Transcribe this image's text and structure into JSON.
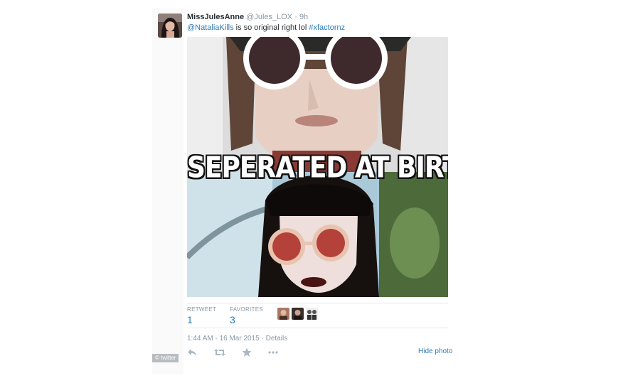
{
  "tweet": {
    "display_name": "MissJulesAnne",
    "handle": "@Jules_LOX",
    "separator": "·",
    "time_ago": "9h",
    "text": {
      "mention": "@NataliaKills",
      "body": " is so original right lol ",
      "hashtag": "#xfactornz"
    },
    "media": {
      "caption": "SEPERATED AT BIRTH??"
    },
    "stats": {
      "retweets_label": "RETWEET",
      "retweets_count": "1",
      "favorites_label": "FAVORITES",
      "favorites_count": "3"
    },
    "timestamp": "1:44 AM - 16 Mar 2015",
    "details_sep": " · ",
    "details_link": "Details",
    "actions": {
      "reply_icon": "reply-icon",
      "retweet_icon": "retweet-icon",
      "favorite_icon": "star-icon",
      "more_icon": "more-icon"
    },
    "hide_photo": "Hide photo"
  },
  "watermark": "© twitter",
  "colors": {
    "link": "#2b7bb9",
    "muted": "#8899a6",
    "text": "#292f33",
    "divider": "#e1e8ed"
  }
}
